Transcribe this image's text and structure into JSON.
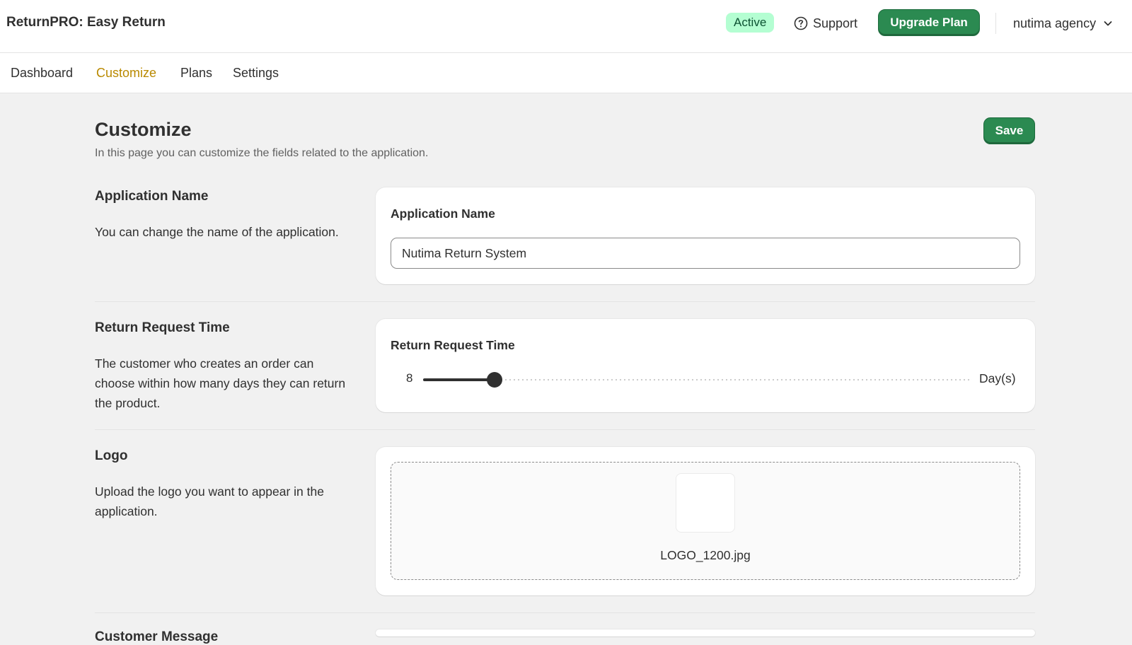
{
  "header": {
    "app_title": "ReturnPRO: Easy Return",
    "status_badge": "Active",
    "support_label": "Support",
    "upgrade_label": "Upgrade Plan",
    "account_name": "nutima agency"
  },
  "nav": {
    "items": [
      {
        "label": "Dashboard",
        "active": false
      },
      {
        "label": "Customize",
        "active": true
      },
      {
        "label": "Plans",
        "active": false
      },
      {
        "label": "Settings",
        "active": false
      }
    ]
  },
  "page": {
    "title": "Customize",
    "subtitle": "In this page you can customize the fields related to the application.",
    "save_label": "Save"
  },
  "sections": {
    "app_name": {
      "title": "Application Name",
      "description": "You can change the name of the application.",
      "field_label": "Application Name",
      "field_value": "Nutima Return System"
    },
    "return_time": {
      "title": "Return Request Time",
      "description": "The customer who creates an order can choose within how many days they can return the product.",
      "field_label": "Return Request Time",
      "value": "8",
      "unit": "Day(s)",
      "fill_fraction": 0.13
    },
    "logo": {
      "title": "Logo",
      "description": "Upload the logo you want to appear in the application.",
      "file_name": "LOGO_1200.jpg"
    },
    "customer_message": {
      "title": "Customer Message"
    }
  },
  "colors": {
    "primary_button": "#2b8a51",
    "active_nav": "#b98900",
    "status_badge_bg": "#b4fed2",
    "status_badge_text": "#0c5132",
    "page_background": "#f1f1f1"
  },
  "icons": [
    "question-circle-icon",
    "chevron-down-icon"
  ]
}
